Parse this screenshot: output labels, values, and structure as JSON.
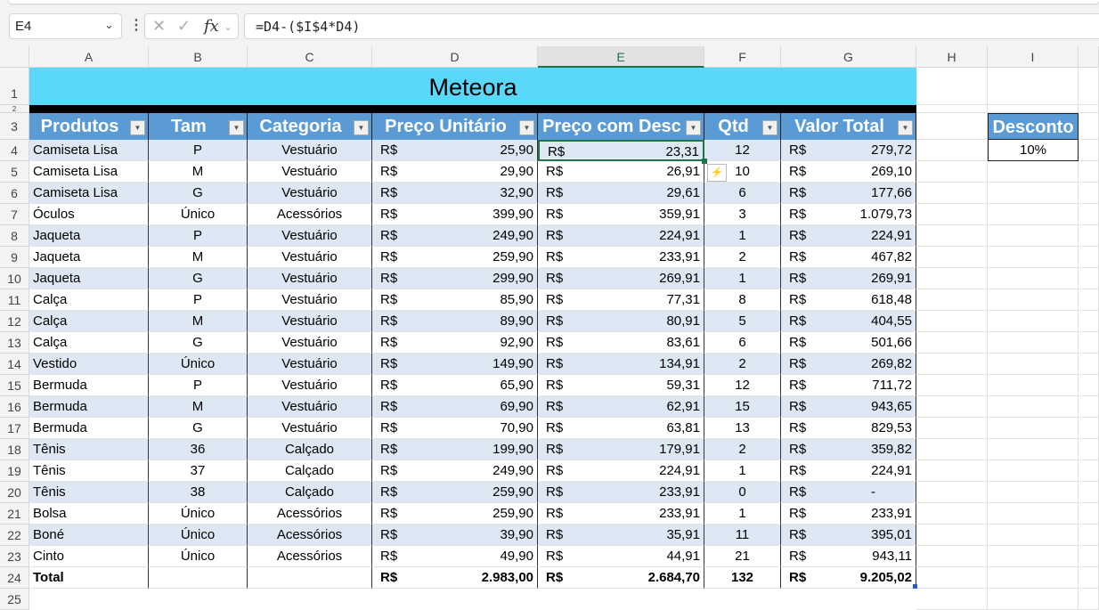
{
  "formula_bar": {
    "name_box": "E4",
    "formula": "=D4-($I$4*D4)",
    "fx": "fx"
  },
  "columns": [
    "A",
    "B",
    "C",
    "D",
    "E",
    "F",
    "G",
    "H",
    "I"
  ],
  "title": "Meteora",
  "headers": [
    "Produtos",
    "Tam",
    "Categoria",
    "Preço Unitário",
    "Preço com Desc",
    "Qtd",
    "Valor Total"
  ],
  "currency": "R$",
  "rows": [
    [
      "Camiseta Lisa",
      "P",
      "Vestuário",
      "25,90",
      "23,31",
      "12",
      "279,72"
    ],
    [
      "Camiseta Lisa",
      "M",
      "Vestuário",
      "29,90",
      "26,91",
      "10",
      "269,10"
    ],
    [
      "Camiseta Lisa",
      "G",
      "Vestuário",
      "32,90",
      "29,61",
      "6",
      "177,66"
    ],
    [
      "Óculos",
      "Único",
      "Acessórios",
      "399,90",
      "359,91",
      "3",
      "1.079,73"
    ],
    [
      "Jaqueta",
      "P",
      "Vestuário",
      "249,90",
      "224,91",
      "1",
      "224,91"
    ],
    [
      "Jaqueta",
      "M",
      "Vestuário",
      "259,90",
      "233,91",
      "2",
      "467,82"
    ],
    [
      "Jaqueta",
      "G",
      "Vestuário",
      "299,90",
      "269,91",
      "1",
      "269,91"
    ],
    [
      "Calça",
      "P",
      "Vestuário",
      "85,90",
      "77,31",
      "8",
      "618,48"
    ],
    [
      "Calça",
      "M",
      "Vestuário",
      "89,90",
      "80,91",
      "5",
      "404,55"
    ],
    [
      "Calça",
      "G",
      "Vestuário",
      "92,90",
      "83,61",
      "6",
      "501,66"
    ],
    [
      "Vestido",
      "Único",
      "Vestuário",
      "149,90",
      "134,91",
      "2",
      "269,82"
    ],
    [
      "Bermuda",
      "P",
      "Vestuário",
      "65,90",
      "59,31",
      "12",
      "711,72"
    ],
    [
      "Bermuda",
      "M",
      "Vestuário",
      "69,90",
      "62,91",
      "15",
      "943,65"
    ],
    [
      "Bermuda",
      "G",
      "Vestuário",
      "70,90",
      "63,81",
      "13",
      "829,53"
    ],
    [
      "Tênis",
      "36",
      "Calçado",
      "199,90",
      "179,91",
      "2",
      "359,82"
    ],
    [
      "Tênis",
      "37",
      "Calçado",
      "249,90",
      "224,91",
      "1",
      "224,91"
    ],
    [
      "Tênis",
      "38",
      "Calçado",
      "259,90",
      "233,91",
      "0",
      "-"
    ],
    [
      "Bolsa",
      "Único",
      "Acessórios",
      "259,90",
      "233,91",
      "1",
      "233,91"
    ],
    [
      "Boné",
      "Único",
      "Acessórios",
      "39,90",
      "35,91",
      "11",
      "395,01"
    ],
    [
      "Cinto",
      "Único",
      "Acessórios",
      "49,90",
      "44,91",
      "21",
      "943,11"
    ]
  ],
  "total": {
    "label": "Total",
    "preco_unitario": "2.983,00",
    "preco_desc": "2.684,70",
    "qtd": "132",
    "valor_total": "9.205,02"
  },
  "desconto": {
    "label": "Desconto",
    "value": "10%"
  },
  "colors": {
    "title_bg": "#5ad8f9",
    "header_bg": "#5b9bd5",
    "stripe": "#dde8f4"
  }
}
